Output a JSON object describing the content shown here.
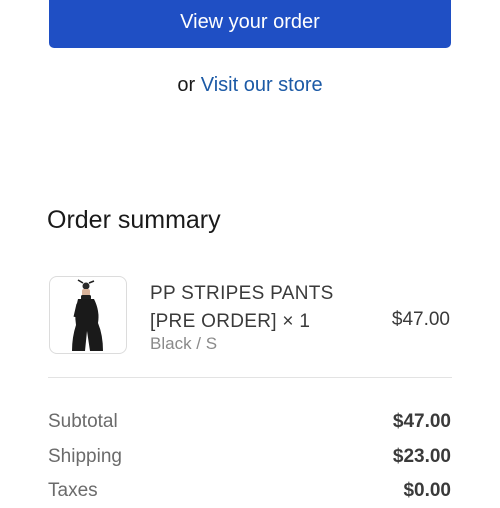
{
  "primary_action": {
    "label": "View your order"
  },
  "secondary_action": {
    "prefix": "or",
    "link_label": "Visit our store"
  },
  "order_summary": {
    "title": "Order summary",
    "item": {
      "name": "PP STRIPES PANTS [PRE ORDER] × 1",
      "variant": "Black / S",
      "price": "$47.00"
    },
    "totals": [
      {
        "label": "Subtotal",
        "value": "$47.00"
      },
      {
        "label": "Shipping",
        "value": "$23.00"
      },
      {
        "label": "Taxes",
        "value": "$0.00"
      }
    ]
  },
  "colors": {
    "primary_button": "#1f4fc4",
    "link": "#1c5aa6"
  }
}
